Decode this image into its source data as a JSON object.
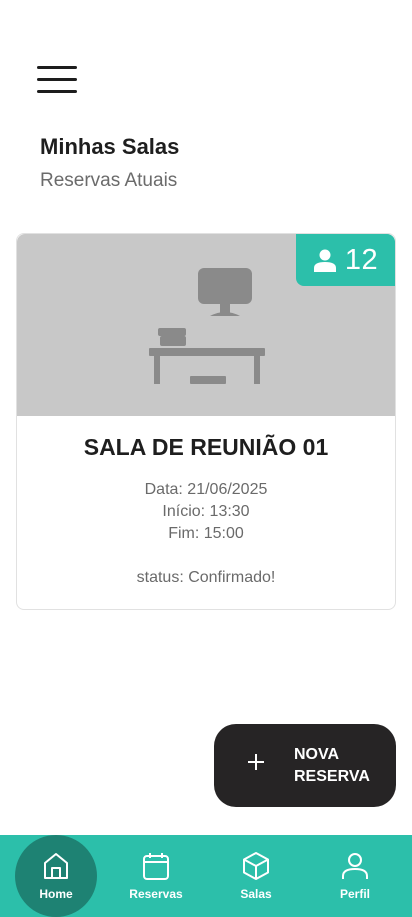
{
  "header": {
    "menu_icon": "hamburger-menu-icon",
    "title": "Minhas Salas",
    "subtitle": "Reservas Atuais"
  },
  "reservation": {
    "image_icon": "desk-computer-icon",
    "capacity_icon": "person-icon",
    "capacity": "12",
    "room_name": "SALA DE REUNIÃO 01",
    "date": "Data: 21/06/2025",
    "start": "Início: 13:30",
    "end": "Fim: 15:00",
    "status": "status: Confirmado!"
  },
  "fab": {
    "icon": "plus-icon",
    "line1": "NOVA",
    "line2": "RESERVA"
  },
  "nav": {
    "items": [
      {
        "label": "Home",
        "icon": "home-icon",
        "active": true
      },
      {
        "label": "Reservas",
        "icon": "calendar-icon",
        "active": false
      },
      {
        "label": "Salas",
        "icon": "cube-icon",
        "active": false
      },
      {
        "label": "Perfil",
        "icon": "user-icon",
        "active": false
      }
    ]
  },
  "colors": {
    "accent": "#2cbfaa",
    "accent_dark": "#1e8273",
    "fab_bg": "#262425",
    "image_bg": "#c8c8c8"
  }
}
